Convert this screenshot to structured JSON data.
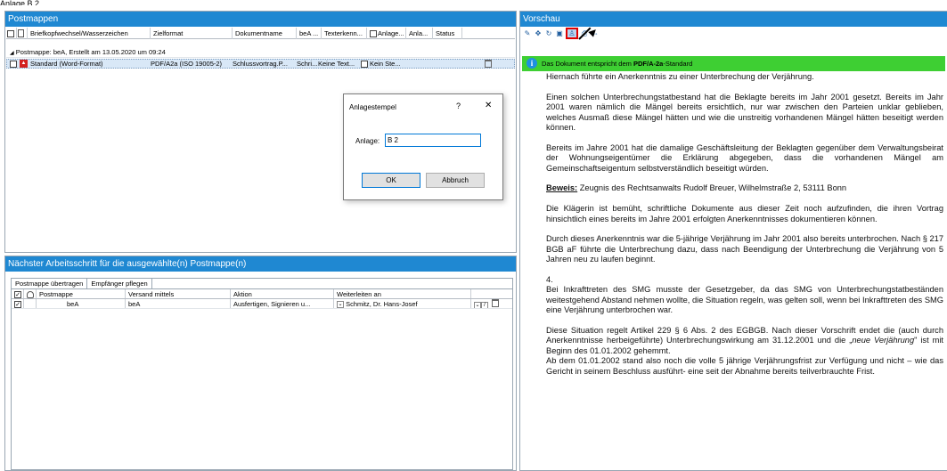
{
  "clip_text": "Anlage B 2 ......... ",
  "postmappen": {
    "title": "Postmappen",
    "columns": [
      "Briefkopfwechsel/Wasserzeichen",
      "Zielformat",
      "Dokumentname",
      "beA ...",
      "Texterkenn...",
      "Anlage...",
      "Anla...",
      "Status"
    ],
    "group_label": "Postmappe: beA, Erstellt am 13.05.2020 um 09:24",
    "row": {
      "name": "Standard (Word-Format)",
      "format": "PDF/A2a (ISO 19005-2)",
      "docname": "Schlussvortrag.P...",
      "bea": "Schri...",
      "texterkennung": "Keine Text...",
      "anlage": "Kein Ste..."
    }
  },
  "dialog": {
    "title": "Anlagestempel",
    "help": "?",
    "close": "✕",
    "label": "Anlage:",
    "value": "B 2",
    "ok": "OK",
    "cancel": "Abbruch"
  },
  "next_step": {
    "title": "Nächster Arbeitsschritt für die ausgewählte(n) Postmappe(n)",
    "tabs": [
      "Postmappe übertragen",
      "Empfänger pflegen"
    ],
    "columns": [
      "Postmappe",
      "Versand mittels",
      "Aktion",
      "Weiterleiten an"
    ],
    "row": {
      "postmappe": "beA",
      "versand": "beA",
      "aktion": "Ausfertigen, Signieren u...",
      "weiterleiten": "Schmitz, Dr. Hans-Josef"
    }
  },
  "vorschau": {
    "title": "Vorschau",
    "conform_prefix": "Das Dokument entspricht dem",
    "conform_bold": "PDF/A-2a",
    "conform_suffix": "-Standard",
    "paragraphs": {
      "p1": "Hiernach führte ein Anerkenntnis zu einer Unterbrechung der Verjährung.",
      "p2": "Einen solchen Unterbrechungstatbestand hat die Beklagte bereits im Jahr 2001 gesetzt. Bereits im Jahr 2001 waren nämlich die Mängel bereits ersichtlich, nur war zwischen den Parteien unklar geblieben, welches Ausmaß diese Mängel hätten und wie die unstreitig vorhandenen Mängel hätten beseitigt werden können.",
      "p3": "Bereits im Jahre 2001 hat die damalige Geschäftsleitung der Beklagten gegenüber dem Verwaltungsbeirat der Wohnungseigentümer die Erklärung abgegeben, dass die vorhandenen Mängel am Gemeinschaftseigentum selbstverständlich beseitigt würden.",
      "beweis_label": "Beweis:",
      "beweis_text": " Zeugnis des Rechtsanwalts Rudolf Breuer, Wilhelmstraße 2, 53111 Bonn",
      "p5": "Die Klägerin ist bemüht, schriftliche Dokumente aus dieser Zeit noch aufzufinden, die ihren Vortrag hinsichtlich eines bereits im Jahre 2001 erfolgten Anerkenntnisses dokumentieren können.",
      "p6": "Durch dieses Anerkenntnis war die 5-jährige Verjährung im Jahr 2001 also bereits unterbrochen. Nach § 217 BGB aF führte die Unterbrechung dazu, dass nach Beendigung der Unterbrechung die Verjährung von 5 Jahren neu zu laufen beginnt.",
      "num4": "4.",
      "p7": "Bei Inkrafttreten des SMG musste der Gesetzgeber, da das SMG von Unterbrechungstatbeständen weitestgehend Abstand nehmen wollte, die Situation regeln, was gelten soll, wenn bei Inkrafttreten des SMG eine Verjährung unterbrochen war.",
      "p8a": "Diese Situation regelt Artikel 229 § 6 Abs. 2 des EGBGB. Nach dieser Vorschrift endet die (auch durch Anerkenntnisse herbeigeführte) Unterbrechungswirkung am 31.12.2001 und die „",
      "p8i": "neue Verjährung",
      "p8b": "\" ist mit Beginn des 01.01.2002 gehemmt.",
      "p9": "Ab dem 01.01.2002 stand also noch die volle 5 jährige Verjährungsfrist zur Verfügung und nicht – wie das Gericht  in seinem Beschluss ausführt- eine seit der Abnahme bereits teilverbrauchte Frist."
    }
  }
}
